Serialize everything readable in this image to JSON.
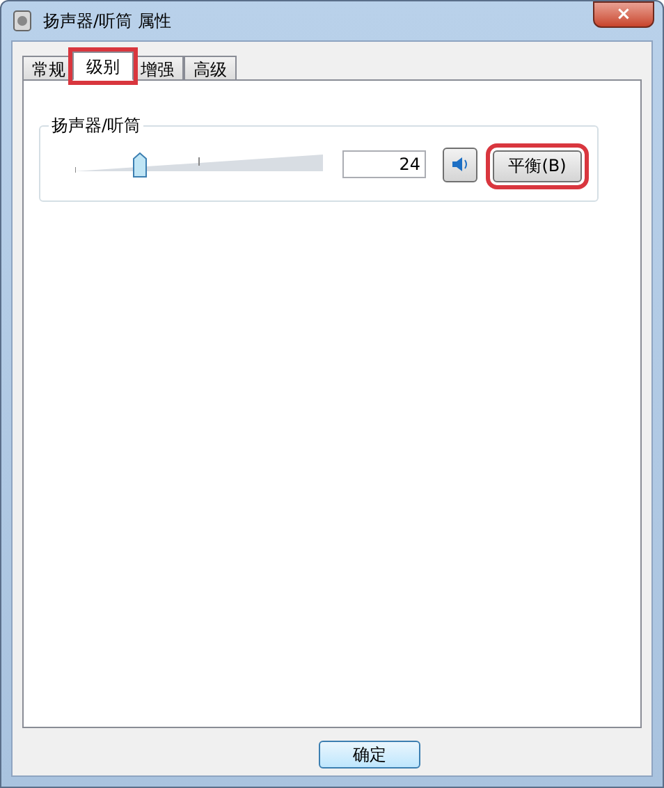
{
  "window": {
    "title": "扬声器/听筒 属性",
    "close": "×"
  },
  "tabs": [
    {
      "label": "常规",
      "selected": false,
      "highlighted": false
    },
    {
      "label": "级别",
      "selected": true,
      "highlighted": true
    },
    {
      "label": "增强",
      "selected": false,
      "highlighted": false
    },
    {
      "label": "高级",
      "selected": false,
      "highlighted": false
    }
  ],
  "group": {
    "title": "扬声器/听筒",
    "slider": {
      "level": 0.24
    },
    "value": "24",
    "mute_button": {
      "muted": false
    },
    "balance_button": {
      "label": "平衡(B)",
      "highlighted": true
    }
  },
  "buttons": [
    {
      "label": "确定"
    }
  ]
}
